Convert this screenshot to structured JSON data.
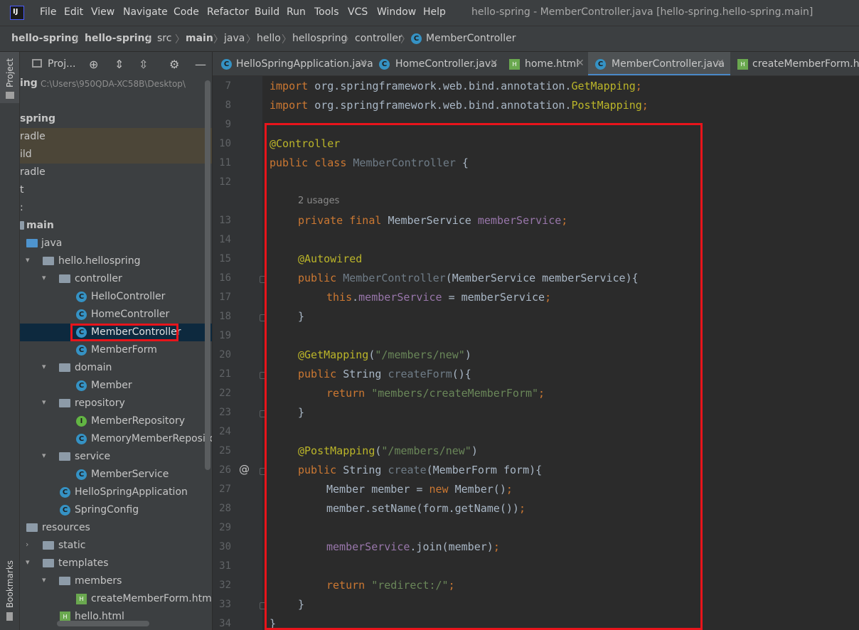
{
  "menubar": {
    "items": [
      "File",
      "Edit",
      "View",
      "Navigate",
      "Code",
      "Refactor",
      "Build",
      "Run",
      "Tools",
      "VCS",
      "Window",
      "Help"
    ],
    "window_title": "hello-spring - MemberController.java [hello-spring.hello-spring.main]"
  },
  "breadcrumb": [
    "hello-spring",
    "hello-spring",
    "src",
    "main",
    "java",
    "hello",
    "hellospring",
    "controller",
    "MemberController"
  ],
  "toolstrip": {
    "project_label": "Project",
    "bookmarks_label": "Bookmarks"
  },
  "project_panel": {
    "title": "Proj...",
    "root_label": "ing",
    "root_path": "C:\\Users\\950QDA-XC58B\\Desktop\\",
    "rows": [
      {
        "label": "spring"
      },
      {
        "label": "radle"
      },
      {
        "label": "ild"
      },
      {
        "label": "radle"
      },
      {
        "label": "t"
      },
      {
        "label": ":"
      },
      {
        "label": "main"
      },
      {
        "label": "java"
      },
      {
        "label": "hello.hellospring"
      },
      {
        "label": "controller"
      },
      {
        "label": "HelloController"
      },
      {
        "label": "HomeController"
      },
      {
        "label": "MemberController"
      },
      {
        "label": "MemberForm"
      },
      {
        "label": "domain"
      },
      {
        "label": "Member"
      },
      {
        "label": "repository"
      },
      {
        "label": "MemberRepository"
      },
      {
        "label": "MemoryMemberRepository"
      },
      {
        "label": "service"
      },
      {
        "label": "MemberService"
      },
      {
        "label": "HelloSpringApplication"
      },
      {
        "label": "SpringConfig"
      },
      {
        "label": "resources"
      },
      {
        "label": "static"
      },
      {
        "label": "templates"
      },
      {
        "label": "members"
      },
      {
        "label": "createMemberForm.html"
      },
      {
        "label": "hello.html"
      }
    ]
  },
  "tabs": [
    {
      "label": "HelloSpringApplication.java"
    },
    {
      "label": "HomeController.java"
    },
    {
      "label": "home.html"
    },
    {
      "label": "MemberController.java"
    },
    {
      "label": "createMemberForm.htm"
    }
  ],
  "editor": {
    "line_numbers": [
      "7",
      "8",
      "9",
      "10",
      "11",
      "12",
      "13",
      "14",
      "15",
      "16",
      "17",
      "18",
      "19",
      "20",
      "21",
      "22",
      "23",
      "24",
      "25",
      "26",
      "27",
      "28",
      "29",
      "30",
      "31",
      "32",
      "33",
      "34"
    ],
    "usages_hint": "2 usages",
    "gutter_marker": "@",
    "code": {
      "l7a": "import ",
      "l7b": "org.springframework.web.bind.annotation.",
      "l7c": "GetMapping",
      "l7d": ";",
      "l8a": "import ",
      "l8b": "org.springframework.web.bind.annotation.",
      "l8c": "PostMapping",
      "l8d": ";",
      "l10": "@Controller",
      "l11a": "public class ",
      "l11b": "MemberController",
      "l11c": " {",
      "l13a": "private final ",
      "l13b": "MemberService ",
      "l13c": "memberService",
      "l13d": ";",
      "l15": "@Autowired",
      "l16a": "public ",
      "l16b": "MemberController",
      "l16c": "(MemberService memberService){",
      "l17a": "this",
      "l17b": ".",
      "l17c": "memberService",
      "l17d": " = memberService",
      "l17e": ";",
      "l18": "}",
      "l20a": "@GetMapping",
      "l20b": "(",
      "l20c": "\"/members/new\"",
      "l20d": ")",
      "l21a": "public ",
      "l21b": "String ",
      "l21c": "createForm",
      "l21d": "(){",
      "l22a": "return ",
      "l22b": "\"members/createMemberForm\"",
      "l22c": ";",
      "l23": "}",
      "l25a": "@PostMapping",
      "l25b": "(",
      "l25c": "\"/members/new\"",
      "l25d": ")",
      "l26a": "public ",
      "l26b": "String ",
      "l26c": "create",
      "l26d": "(MemberForm form){",
      "l27a": "Member member = ",
      "l27b": "new ",
      "l27c": "Member()",
      "l27d": ";",
      "l28a": "member.setName(form.getName())",
      "l28b": ";",
      "l30a": "memberService",
      "l30b": ".join(member)",
      "l30c": ";",
      "l32a": "return ",
      "l32b": "\"redirect:/\"",
      "l32c": ";",
      "l33": "}",
      "l34": "}"
    }
  },
  "colors": {
    "highlight_box": "#e8141b",
    "selection": "#0d293e",
    "keyword": "#cc7832",
    "annotation": "#bbb529",
    "string": "#6a8759",
    "field": "#9876aa"
  }
}
